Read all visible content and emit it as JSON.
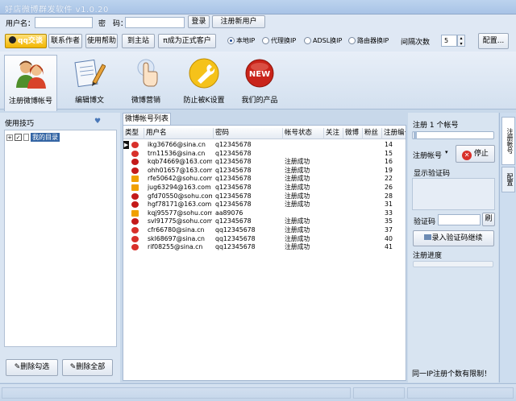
{
  "window": {
    "title": "好店微博群发软件 v1.0.20"
  },
  "login": {
    "user_label": "用户名：",
    "pass_label": "密　码：",
    "login_button": "登录",
    "register_button": "注册新用户"
  },
  "actions": {
    "qq_chat": "qq交谈",
    "contact_author": "联系作者",
    "help": "使用帮助",
    "homepage": "到主站",
    "become_customer": "成为正式客户"
  },
  "network": {
    "options": [
      {
        "label": "本地IP",
        "selected": true
      },
      {
        "label": "代理换IP",
        "selected": false
      },
      {
        "label": "ADSL换IP",
        "selected": false
      },
      {
        "label": "路由器换IP",
        "selected": false
      }
    ],
    "interval_label": "间隔次数",
    "interval_value": "5",
    "config_button": "配置..."
  },
  "toolbar": {
    "items": [
      {
        "label": "注册微博帐号",
        "icon": "people-icon"
      },
      {
        "label": "编辑博文",
        "icon": "edit-document-icon"
      },
      {
        "label": "微博营销",
        "icon": "pointer-hand-icon"
      },
      {
        "label": "防止被K设置",
        "icon": "wrench-icon"
      },
      {
        "label": "我们的产品",
        "icon": "new-badge-icon"
      }
    ]
  },
  "left_panel": {
    "title": "使用技巧",
    "tree_root": "我的目录",
    "delete_checked": "删除勾选",
    "delete_all": "删除全部"
  },
  "accounts": {
    "tab_label": "微博帐号列表",
    "columns": [
      "类型",
      "用户名",
      "密码",
      "帐号状态",
      "关注",
      "微博",
      "粉丝",
      "注册编号"
    ],
    "rows": [
      {
        "type": "weibo",
        "username": "ikg36766@sina.cn",
        "password": "q12345678",
        "status": "",
        "num": "14"
      },
      {
        "type": "weibo",
        "username": "trn11536@sina.cn",
        "password": "q12345678",
        "status": "",
        "num": "15"
      },
      {
        "type": "netease",
        "username": "kqb74669@163.com",
        "password": "q12345678",
        "status": "注册成功",
        "num": "16"
      },
      {
        "type": "netease",
        "username": "ohh01657@163.com",
        "password": "q12345678",
        "status": "注册成功",
        "num": "19"
      },
      {
        "type": "sohu",
        "username": "rfe50642@sohu.com",
        "password": "q12345678",
        "status": "注册成功",
        "num": "22"
      },
      {
        "type": "sohu",
        "username": "jug63294@163.com",
        "password": "q12345678",
        "status": "注册成功",
        "num": "26"
      },
      {
        "type": "netease",
        "username": "gfd70550@sohu.com",
        "password": "q12345678",
        "status": "注册成功",
        "num": "28"
      },
      {
        "type": "netease",
        "username": "hgf78171@163.com",
        "password": "q12345678",
        "status": "注册成功",
        "num": "31"
      },
      {
        "type": "sohu",
        "username": "kqj95577@sohu.com",
        "password": "aa89076",
        "status": "",
        "num": "33"
      },
      {
        "type": "netease",
        "username": "svl91775@sohu.com",
        "password": "q12345678",
        "status": "注册成功",
        "num": "35"
      },
      {
        "type": "weibo",
        "username": "cfr66780@sina.cn",
        "password": "qq12345678",
        "status": "注册成功",
        "num": "37"
      },
      {
        "type": "weibo",
        "username": "skl68697@sina.cn",
        "password": "qq12345678",
        "status": "注册成功",
        "num": "40"
      },
      {
        "type": "weibo",
        "username": "rif08255@sina.cn",
        "password": "qq12345678",
        "status": "注册成功",
        "num": "41"
      }
    ]
  },
  "register_panel": {
    "register_count_label": "注册 1 个帐号",
    "register_account_label": "注册帐号",
    "stop_button": "停止",
    "show_captcha_label": "显示验证码",
    "captcha_label": "验证码",
    "refresh_button": "刷",
    "continue_button": "录入验证码继续",
    "progress_label": "注册进度",
    "progress": 0,
    "limit_notice": "同一IP注册个数有限制！"
  },
  "side_tabs": [
    "注册帐号",
    "配置"
  ],
  "colors": {
    "accent": "#1f4c9a",
    "stop": "#d8302a",
    "qq": "#f2b600"
  }
}
